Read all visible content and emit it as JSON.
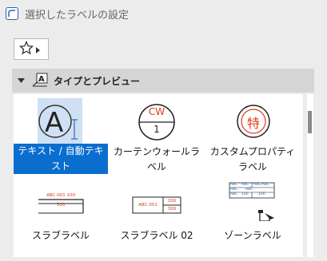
{
  "window": {
    "title": "選択したラベルの設定"
  },
  "section": {
    "title": "タイプとプレビュー"
  },
  "items": [
    {
      "label": "テキスト / 自動テキスト"
    },
    {
      "label": "カーテンウォールラベル",
      "cw_top": "CW",
      "cw_bottom": "1"
    },
    {
      "label": "カスタムプロパティラベル",
      "symbol": "特"
    },
    {
      "label": "スラブラベル",
      "top_text": "ABC-001 100",
      "bottom_text": "300"
    },
    {
      "label": "スラブラベル 02",
      "left_text": "ABC-001",
      "right_top": "200",
      "right_bottom": "300"
    },
    {
      "label": "ゾーンラベル",
      "cells": [
        "ABC",
        "ABC",
        "ABC/ABC",
        "ABC",
        "ABC",
        "ABC",
        "100",
        "100"
      ]
    }
  ],
  "colors": {
    "accent": "#0a6ecf",
    "label_red": "#e03a1c"
  }
}
